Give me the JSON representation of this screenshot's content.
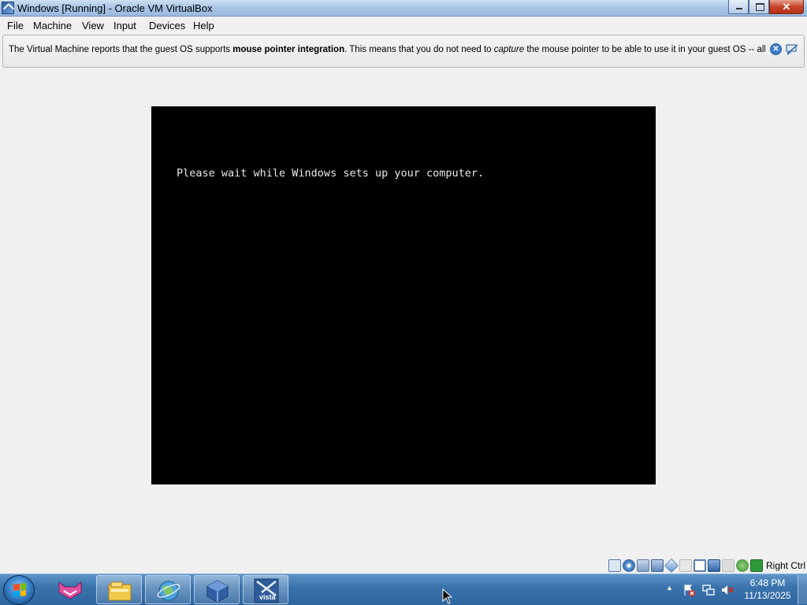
{
  "window": {
    "title": "Windows [Running] - Oracle VM VirtualBox",
    "close_glyph": "✕"
  },
  "menu": [
    "File",
    "Machine",
    "View",
    "Input",
    "Devices",
    "Help"
  ],
  "notification": {
    "part1": "The Virtual Machine reports that the guest OS supports ",
    "bold": "mouse pointer integration",
    "part2": ". This means that you do not need to ",
    "italic": "capture",
    "part3": " the mouse pointer to be able to use it in your guest OS -- all mouse",
    "close_glyph": "✕"
  },
  "vm_screen": {
    "text": "Please wait while Windows sets up your computer."
  },
  "statusbar": {
    "host_key": "Right Ctrl",
    "icons": [
      "hard-disk-icon",
      "optical-drive-icon",
      "audio-icon",
      "network-icon",
      "usb-icon",
      "shared-folders-icon",
      "display-icon",
      "video-capture-icon",
      "recording-icon",
      "mouse-integration-icon",
      "cpu-icon",
      "keyboard-icon"
    ]
  },
  "taskbar": {
    "buttons": [
      "start-button",
      "vpn-app-icon",
      "file-explorer-icon",
      "browser-icon",
      "virtualbox-icon",
      "vista-vm-icon"
    ],
    "vista_label": "vista",
    "clock_time": "6:48 PM",
    "clock_date": "11/13/2025",
    "tray_arrow": "▲"
  },
  "colors": {
    "taskbar": "#3b73ad",
    "vm_background": "#000000",
    "titlebar": "#a9c5e6",
    "close_button": "#c7432a"
  }
}
